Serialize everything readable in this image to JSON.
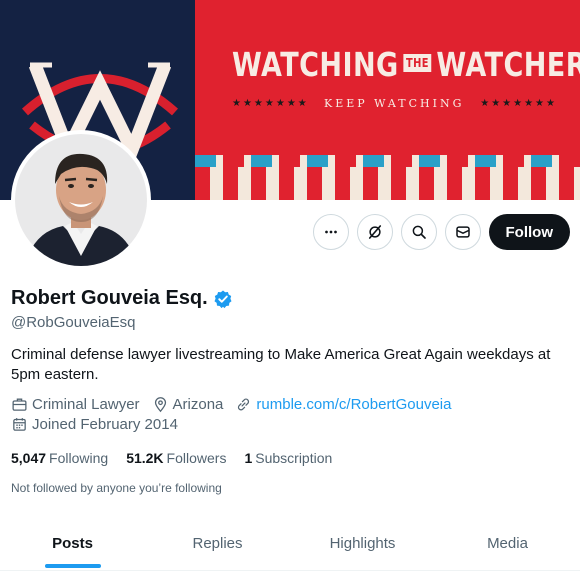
{
  "banner": {
    "title_left": "WATCHING",
    "title_mid": "THE",
    "title_right": "WATCHERS",
    "subtitle": "KEEP WATCHING",
    "stars": "★★★★★★★",
    "colors": {
      "navy": "#142243",
      "red": "#e0222f",
      "cream": "#f7ece4",
      "blue": "#2aa0c8"
    }
  },
  "avatar": {
    "icon": "profile-photo"
  },
  "actions": {
    "more_icon": "more-horizontal-icon",
    "grok_icon": "grok-icon",
    "search_icon": "search-icon",
    "message_icon": "message-icon",
    "follow_label": "Follow"
  },
  "profile": {
    "name": "Robert Gouveia Esq.",
    "verified_icon": "verified-badge-icon",
    "handle": "@RobGouveiaEsq",
    "bio": "Criminal defense lawyer livestreaming to Make America Great Again weekdays at 5pm eastern.",
    "category": "Criminal Lawyer",
    "location": "Arizona",
    "website": "rumble.com/c/RobertGouveia",
    "joined": "Joined February 2014"
  },
  "stats": {
    "following_count": "5,047",
    "following_label": "Following",
    "followers_count": "51.2K",
    "followers_label": "Followers",
    "subscription_count": "1",
    "subscription_label": "Subscription"
  },
  "followed_note": "Not followed by anyone you’re following",
  "tabs": [
    {
      "label": "Posts",
      "active": true
    },
    {
      "label": "Replies",
      "active": false
    },
    {
      "label": "Highlights",
      "active": false
    },
    {
      "label": "Media",
      "active": false
    }
  ],
  "accent": "#1d9bf0"
}
